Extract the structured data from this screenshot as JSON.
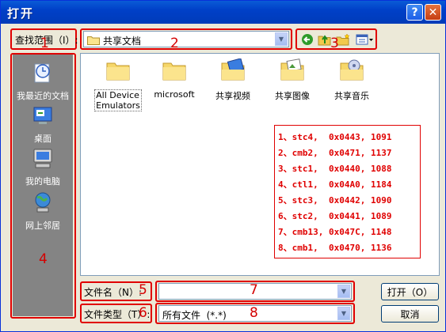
{
  "window": {
    "title": "打开"
  },
  "titlebar": {
    "help_glyph": "?",
    "close_glyph": "✕"
  },
  "lookin": {
    "label": "查找范围（I）:",
    "value": "共享文档"
  },
  "toolbar": {
    "back": "back-icon",
    "up": "up-folder-icon",
    "newfolder": "new-folder-icon",
    "views": "views-menu-icon"
  },
  "places": [
    {
      "label": "我最近的文档",
      "icon": "recent-documents-icon"
    },
    {
      "label": "桌面",
      "icon": "desktop-icon"
    },
    {
      "label": "我的电脑",
      "icon": "my-computer-icon"
    },
    {
      "label": "网上邻居",
      "icon": "network-places-icon"
    }
  ],
  "files": [
    {
      "label": "All Device Emulators",
      "line1": "All Device",
      "line2": "Emulators",
      "icon": "folder-icon"
    },
    {
      "label": "microsoft",
      "icon": "folder-icon"
    },
    {
      "label": "共享视频",
      "icon": "shared-video-folder-icon"
    },
    {
      "label": "共享图像",
      "icon": "shared-pictures-folder-icon"
    },
    {
      "label": "共享音乐",
      "icon": "shared-music-folder-icon"
    }
  ],
  "annotations": [
    "1、stc4,  0x0443, 1091",
    "2、cmb2,  0x0471, 1137",
    "3、stc1,  0x0440, 1088",
    "4、ctl1,  0x04A0, 1184",
    "5、stc3,  0x0442, 1090",
    "6、stc2,  0x0441, 1089",
    "7、cmb13, 0x047C, 1148",
    "8、cmb1,  0x0470, 1136"
  ],
  "callouts": {
    "n1": "1",
    "n2": "2",
    "n3": "3",
    "n4": "4",
    "n5": "5",
    "n6": "6",
    "n7": "7",
    "n8": "8"
  },
  "filename": {
    "label": "文件名（N）:",
    "value": ""
  },
  "filetype": {
    "label": "文件类型（T）:",
    "value": "所有文件  (*.*)"
  },
  "buttons": {
    "open": "打开（O）",
    "cancel": "取消"
  },
  "colors": {
    "annotation_red": "#e00000",
    "titlebar_blue": "#0040c8",
    "dialog_bg": "#ece9d8"
  }
}
